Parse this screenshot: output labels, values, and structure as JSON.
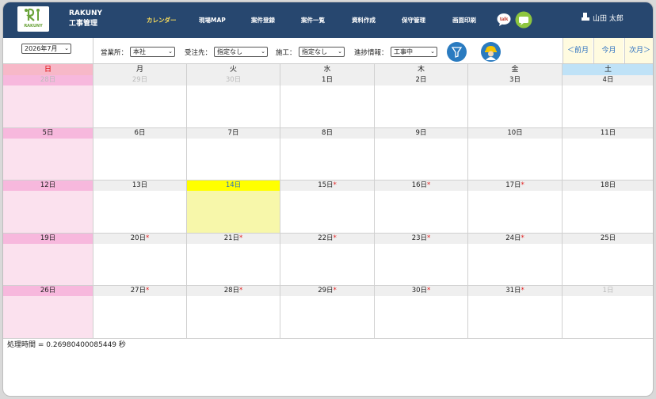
{
  "header": {
    "logo_text": "RAKUNY",
    "app_title_line1": "RAKUNY",
    "app_title_line2": "工事管理",
    "nav": [
      {
        "label": "カレンダー",
        "active": true
      },
      {
        "label": "現場MAP"
      },
      {
        "label": "案件登録"
      },
      {
        "label": "案件一覧"
      },
      {
        "label": "資料作成"
      },
      {
        "label": "保守管理"
      },
      {
        "label": "画面印刷"
      }
    ],
    "talk_label": "talk",
    "user_name": "山田 太郎"
  },
  "filters": {
    "month": "2026年7月",
    "office_label": "営業所：",
    "office_value": "本社",
    "client_label": "受注先：",
    "client_value": "指定なし",
    "builder_label": "施工：",
    "builder_value": "指定なし",
    "progress_label": "進捗情報：",
    "progress_value": "工事中",
    "prev_month": "＜前月",
    "this_month": "今月",
    "next_month": "次月＞"
  },
  "calendar": {
    "weekdays": [
      "日",
      "月",
      "火",
      "水",
      "木",
      "金",
      "土"
    ],
    "weeks": [
      [
        {
          "d": "28日",
          "other": true
        },
        {
          "d": "29日",
          "other": true
        },
        {
          "d": "30日",
          "other": true
        },
        {
          "d": "1日"
        },
        {
          "d": "2日"
        },
        {
          "d": "3日"
        },
        {
          "d": "4日"
        }
      ],
      [
        {
          "d": "5日"
        },
        {
          "d": "6日"
        },
        {
          "d": "7日"
        },
        {
          "d": "8日"
        },
        {
          "d": "9日"
        },
        {
          "d": "10日"
        },
        {
          "d": "11日"
        }
      ],
      [
        {
          "d": "12日"
        },
        {
          "d": "13日"
        },
        {
          "d": "14日",
          "today": true
        },
        {
          "d": "15日",
          "star": true
        },
        {
          "d": "16日",
          "star": true
        },
        {
          "d": "17日",
          "star": true
        },
        {
          "d": "18日"
        }
      ],
      [
        {
          "d": "19日"
        },
        {
          "d": "20日",
          "star": true
        },
        {
          "d": "21日",
          "star": true
        },
        {
          "d": "22日",
          "star": true
        },
        {
          "d": "23日",
          "star": true
        },
        {
          "d": "24日",
          "star": true
        },
        {
          "d": "25日"
        }
      ],
      [
        {
          "d": "26日"
        },
        {
          "d": "27日",
          "star": true
        },
        {
          "d": "28日",
          "star": true
        },
        {
          "d": "29日",
          "star": true
        },
        {
          "d": "30日",
          "star": true
        },
        {
          "d": "31日",
          "star": true
        },
        {
          "d": "1日",
          "other": true
        }
      ]
    ],
    "star_mark": "*"
  },
  "footer": {
    "processing_time": "処理時間 = 0.26980400085449 秒"
  },
  "colors": {
    "header_bg": "#27476f",
    "active_nav": "#ffe05a",
    "sunday": "#f7b8dd",
    "saturday_head": "#bfe2f7",
    "today": "#ffff00",
    "accent_blue": "#2a7bc0"
  }
}
